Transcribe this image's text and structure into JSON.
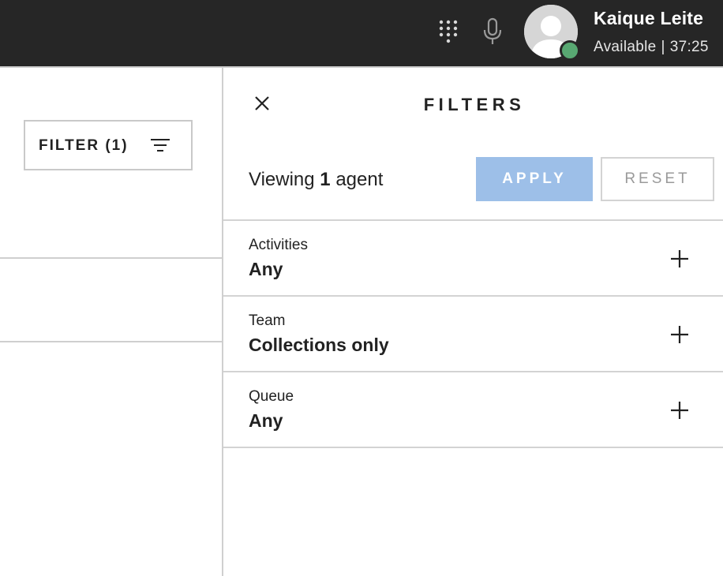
{
  "header": {
    "icons": [
      "dialpad-icon",
      "microphone-icon"
    ],
    "user": {
      "name": "Kaique Leite",
      "status": "Available",
      "separator": "|",
      "timer": "37:25",
      "status_color": "#58a872"
    },
    "background": "#262626"
  },
  "left_panel": {
    "filter_button_label": "FILTER (1)",
    "filter_icon": "filter-lines-icon"
  },
  "filters_panel": {
    "title": "FILTERS",
    "viewing": {
      "prefix": "Viewing",
      "count": "1",
      "suffix": "agent"
    },
    "apply_label": "APPLY",
    "reset_label": "RESET",
    "apply_color": "#9dbfe8",
    "rows": [
      {
        "label": "Activities",
        "value": "Any"
      },
      {
        "label": "Team",
        "value": "Collections only"
      },
      {
        "label": "Queue",
        "value": "Any"
      }
    ]
  }
}
